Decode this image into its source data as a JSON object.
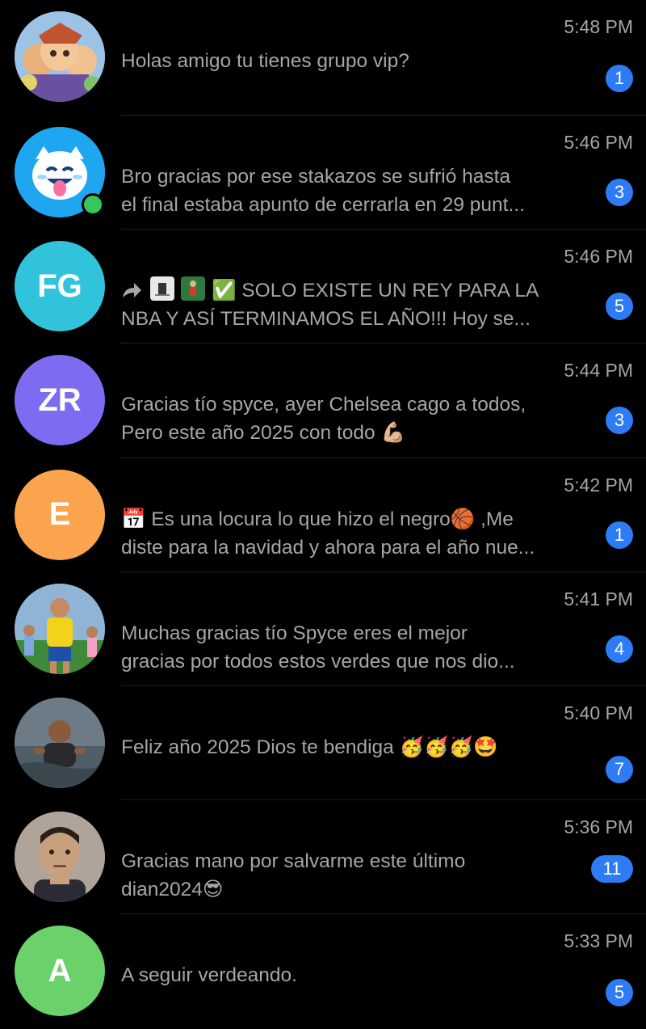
{
  "chats": [
    {
      "avatar": {
        "kind": "image",
        "icon": "cartoon-game-characters-avatar",
        "bg": "#8fb7d9"
      },
      "time": "5:48 PM",
      "lines": [
        "Holas amigo tu tienes grupo vip?"
      ],
      "unread": "1"
    },
    {
      "avatar": {
        "kind": "image",
        "icon": "blue-creature-tongue-avatar",
        "bg": "#27a9ef"
      },
      "online": true,
      "time": "5:46 PM",
      "lines": [
        "Bro gracias por ese stakazos se sufrió hasta",
        "el final estaba apunto de cerrarla en 29 punt..."
      ],
      "unread": "3"
    },
    {
      "avatar": {
        "kind": "initials",
        "initials": "FG",
        "bg": "#32c3dc"
      },
      "time": "5:46 PM",
      "forwarded": true,
      "lines": [
        "✅ SOLO EXISTE UN REY PARA LA",
        "NBA Y ASÍ TERMINAMOS EL AÑO!!! Hoy se..."
      ],
      "unread": "5"
    },
    {
      "avatar": {
        "kind": "initials",
        "initials": "ZR",
        "bg": "#7d6cf2"
      },
      "time": "5:44 PM",
      "lines": [
        "Gracias tío spyce, ayer Chelsea cago a todos,",
        "Pero este año 2025 con todo 💪🏼"
      ],
      "unread": "3"
    },
    {
      "avatar": {
        "kind": "initials",
        "initials": "E",
        "bg": "#fba44d"
      },
      "time": "5:42 PM",
      "lines": [
        "📅 Es una locura lo que hizo el negro🏀 ,Me",
        "diste para la navidad y ahora para el año nue..."
      ],
      "unread": "1"
    },
    {
      "avatar": {
        "kind": "image",
        "icon": "soccer-player-photo-avatar",
        "bg": "#3f7f3a"
      },
      "time": "5:41 PM",
      "lines": [
        "Muchas gracias tío Spyce eres el mejor",
        "gracias por todos estos verdes que nos dio..."
      ],
      "unread": "4"
    },
    {
      "avatar": {
        "kind": "image",
        "icon": "man-in-water-photo-avatar",
        "bg": "#5d6a74"
      },
      "time": "5:40 PM",
      "lines": [
        "Feliz año 2025 Dios te bendiga 🥳🥳🥳🤩"
      ],
      "unread": "7"
    },
    {
      "avatar": {
        "kind": "image",
        "icon": "man-selfie-photo-avatar",
        "bg": "#8a7a70"
      },
      "time": "5:36 PM",
      "lines": [
        "Gracias mano por salvarme este último",
        "dian2024😎"
      ],
      "unread": "11"
    },
    {
      "avatar": {
        "kind": "initials",
        "initials": "A",
        "bg": "#6bd16b"
      },
      "time": "5:33 PM",
      "lines": [
        "A seguir verdeando."
      ],
      "unread": "5"
    }
  ]
}
